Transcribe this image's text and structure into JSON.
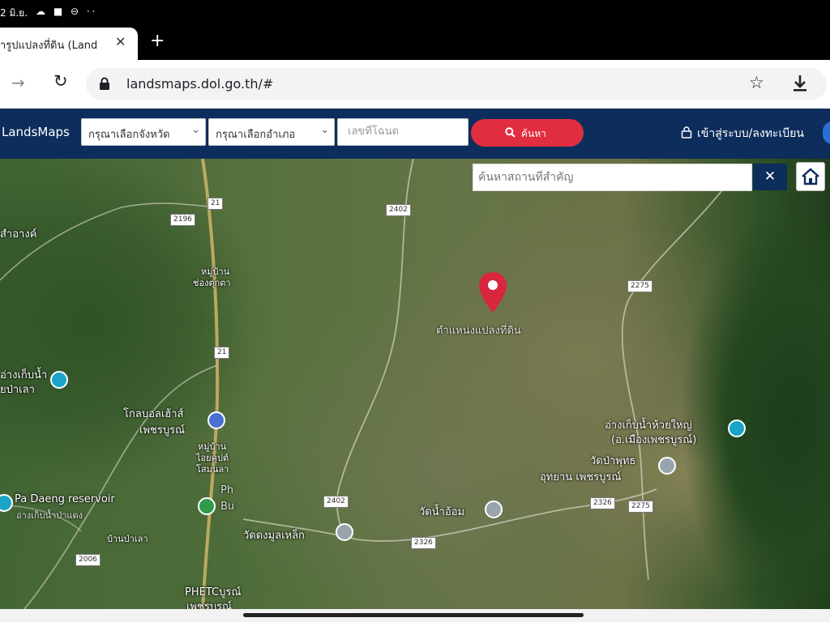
{
  "status_bar": {
    "time": "2 มิ.ย.",
    "icons": "☁ ■ ⊖ ··"
  },
  "tab": {
    "title": "ารูปแปลงที่ดิน (Land",
    "close": "✕",
    "new_tab": "+"
  },
  "address_bar": {
    "url": "landsmaps.dol.go.th/#"
  },
  "site_nav": {
    "brand": "LandsMaps",
    "province_select": "กรุณาเลือกจังหวัด",
    "district_select": "กรุณาเลือกอำเภอ",
    "parcel_placeholder": "เลขที่โฉนด",
    "search_label": "ค้นหา",
    "login_label": "เข้าสู่ระบบ/ลงทะเบียน"
  },
  "map": {
    "search_placeholder": "ค้นหาสถานที่สำคัญ",
    "clear_label": "✕",
    "marker_label": "ตำแหน่งแปลงที่ดิน",
    "places": {
      "sam_ang": "สำอางค์",
      "village_1": "หมู่บ้าน",
      "village_1b": "ช่องตุกตา",
      "reservoir_left_1": "อ่างเก็บน้ำ",
      "reservoir_left_2": "ยป่าเลา",
      "global_house_1": "โกลบอลเฮ้าส์",
      "global_house_2": "เพชรบูรณ์",
      "village_2": "หมู่บ้าน",
      "village_2b": "ไอยคุปต์",
      "village_2c": "โสมนลา",
      "pa_daeng": "Pa Daeng reservoir",
      "pa_daeng_th": "อ่างเก็บน้ำป่าแดง",
      "ban_pa_lao": "บ้านป่าเลา",
      "ph_label_1": "Ph",
      "ph_label_2": "Bu",
      "wat_dong": "วัดดงมูลเหล็ก",
      "wat_nam_om": "วัดน้ำอ้อม",
      "reservoir_right_1": "อ่างเก็บน้ำห้วยใหญ่",
      "reservoir_right_2": "(อ.เมืองเพชรบูรณ์)",
      "wat_pa_1": "วัดป่าพุทธ",
      "wat_pa_2": "อุทยาน เพชรบูรณ์",
      "phet_1": "PHETCบูรณ์",
      "phet_2": "เพชรบูรณ์"
    },
    "road_shields": {
      "r21a": "21",
      "r2196": "2196",
      "r21b": "21",
      "r2402a": "2402",
      "r2275a": "2275",
      "r2402b": "2402",
      "r2326a": "2326",
      "r2326b": "2326",
      "r2275b": "2275",
      "r2006": "2006"
    }
  }
}
